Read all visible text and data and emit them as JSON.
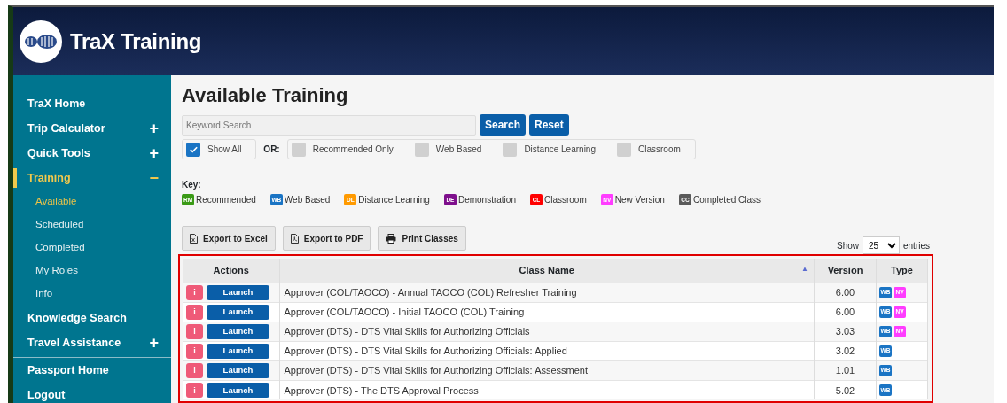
{
  "header": {
    "title": "TraX Training"
  },
  "sidebar": {
    "primary": [
      {
        "label": "TraX Home",
        "selected": false
      },
      {
        "label": "Trip Calculator",
        "selected": false,
        "toggle": "+"
      },
      {
        "label": "Quick Tools",
        "selected": false,
        "toggle": "+"
      },
      {
        "label": "Training",
        "selected": true,
        "toggle": "−",
        "children": [
          {
            "label": "Available",
            "selected": true
          },
          {
            "label": "Scheduled",
            "selected": false
          },
          {
            "label": "Completed",
            "selected": false
          },
          {
            "label": "My Roles",
            "selected": false
          },
          {
            "label": "Info",
            "selected": false
          }
        ]
      },
      {
        "label": "Knowledge Search",
        "selected": false
      },
      {
        "label": "Travel Assistance",
        "selected": false,
        "toggle": "+"
      }
    ],
    "secondary": [
      {
        "label": "Passport Home",
        "selected": false
      },
      {
        "label": "Logout",
        "selected": false
      }
    ]
  },
  "page_title": "Available Training",
  "search": {
    "placeholder": "Keyword Search",
    "buttons": [
      "Search",
      "Reset"
    ]
  },
  "filters": {
    "show_all": {
      "label": "Show All",
      "checked": true
    },
    "or_label": "OR:",
    "options": [
      {
        "label": "Recommended Only",
        "checked": false
      },
      {
        "label": "Web Based",
        "checked": false
      },
      {
        "label": "Distance Learning",
        "checked": false
      },
      {
        "label": "Classroom",
        "checked": false
      }
    ]
  },
  "key": {
    "label": "Key:",
    "items": [
      {
        "code": "RM",
        "label": "Recommended",
        "color": "#3a9a16"
      },
      {
        "code": "WB",
        "label": "Web Based",
        "color": "#1a74c4"
      },
      {
        "code": "DL",
        "label": "Distance Learning",
        "color": "#ff9a00"
      },
      {
        "code": "DE",
        "label": "Demonstration",
        "color": "#7e0f8c"
      },
      {
        "code": "CL",
        "label": "Classroom",
        "color": "#ff0000"
      },
      {
        "code": "NV",
        "label": "New Version",
        "color": "#ff3dff"
      },
      {
        "code": "CC",
        "label": "Completed Class",
        "color": "#5a5a5a"
      }
    ]
  },
  "export_buttons": [
    {
      "label": "Export to Excel",
      "kind": "excel"
    },
    {
      "label": "Export to PDF",
      "kind": "pdf"
    },
    {
      "label": "Print Classes",
      "kind": "print"
    }
  ],
  "length": {
    "before": "Show",
    "value": "25",
    "after": "entries"
  },
  "table": {
    "columns": [
      {
        "label": "Actions"
      },
      {
        "label": "Class Name",
        "sort_mark": "▲"
      },
      {
        "label": "Version"
      },
      {
        "label": "Type"
      }
    ],
    "rows": [
      {
        "info": "i",
        "launch": "Launch",
        "class_name": "Approver (COL/TAOCO) - Annual TAOCO (COL) Refresher Training",
        "version": "6.00",
        "types": [
          {
            "code": "WB",
            "color": "#1a74c4"
          },
          {
            "code": "NV",
            "color": "#ff3dff"
          }
        ]
      },
      {
        "info": "i",
        "launch": "Launch",
        "class_name": "Approver (COL/TAOCO) - Initial TAOCO (COL) Training",
        "version": "6.00",
        "types": [
          {
            "code": "WB",
            "color": "#1a74c4"
          },
          {
            "code": "NV",
            "color": "#ff3dff"
          }
        ]
      },
      {
        "info": "i",
        "launch": "Launch",
        "class_name": "Approver (DTS) - DTS Vital Skills for Authorizing Officials",
        "version": "3.03",
        "types": [
          {
            "code": "WB",
            "color": "#1a74c4"
          },
          {
            "code": "NV",
            "color": "#ff3dff"
          }
        ]
      },
      {
        "info": "i",
        "launch": "Launch",
        "class_name": "Approver (DTS) - DTS Vital Skills for Authorizing Officials: Applied",
        "version": "3.02",
        "types": [
          {
            "code": "WB",
            "color": "#1a74c4"
          }
        ]
      },
      {
        "info": "i",
        "launch": "Launch",
        "class_name": "Approver (DTS) - DTS Vital Skills for Authorizing Officials: Assessment",
        "version": "1.01",
        "types": [
          {
            "code": "WB",
            "color": "#1a74c4"
          }
        ]
      },
      {
        "info": "i",
        "launch": "Launch",
        "class_name": "Approver (DTS) - The DTS Approval Process",
        "version": "5.02",
        "types": [
          {
            "code": "WB",
            "color": "#1a74c4"
          }
        ]
      }
    ]
  }
}
